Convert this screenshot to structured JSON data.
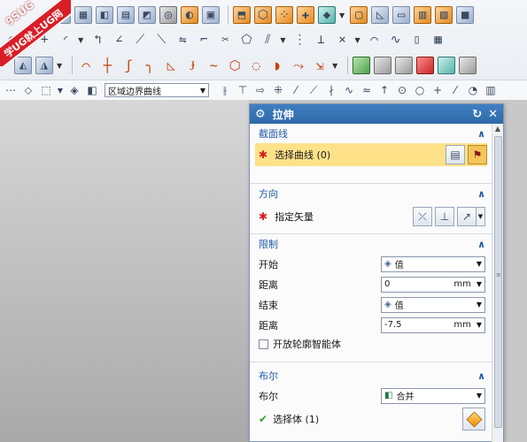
{
  "logo": {
    "brand": "9SUG",
    "tagline": "学UG就上UG网"
  },
  "toolbar": {
    "row1": [
      "blend-icon",
      "mesh-icon",
      "sketch-sheet-icon",
      "grid-surface-icon",
      "patch-icon",
      "tube-icon",
      "split-face-icon",
      "cube-feature-icon",
      "offset-face-icon",
      "pattern-icon",
      "dots-icon",
      "shape-add-icon",
      "color-shape-icon",
      "box-icon",
      "slope-icon",
      "flat-plate-icon",
      "panel-icon",
      "window-icon",
      "solid-cube-icon",
      "shade-face-icon",
      "sheet-icon"
    ],
    "row2": [
      "circle-icon",
      "plus-icon",
      "fillet-sketch-icon",
      "dimension-icon",
      "angle-icon",
      "trim-icon",
      "extend-icon",
      "mirror-icon",
      "corner-icon",
      "split-icon",
      "polygon-icon",
      "offset-icon",
      "pattern-curve-icon",
      "project-icon",
      "intersect-icon",
      "bridge-icon",
      "blend-curve-icon",
      "pipe-icon",
      "table-icon"
    ],
    "row3": [
      "curve-a-icon",
      "curve-b-icon",
      "curve-c-icon",
      "curve-d-icon",
      "curve-e-icon",
      "curve-f-icon",
      "curve-g-icon",
      "curve-h-icon",
      "curve-i-icon",
      "curve-j-icon",
      "curve-k-icon",
      "curve-l-icon",
      "solid-green-icon",
      "solid-gray-icon",
      "solid-gray2-icon",
      "solid-red-icon",
      "solid-teal-icon",
      "solid-gray3-icon"
    ]
  },
  "selbar": {
    "curve_rule": "区域边界曲线"
  },
  "dialog": {
    "title": "拉伸",
    "sections": {
      "section": {
        "title": "截面线",
        "select_curve": "选择曲线 (0)"
      },
      "direction": {
        "title": "方向",
        "specify_vector": "指定矢量"
      },
      "limits": {
        "title": "限制",
        "start_label": "开始",
        "start_value": "值",
        "dist1_label": "距离",
        "dist1_value": "0",
        "dist1_unit": "mm",
        "end_label": "结束",
        "end_value": "值",
        "dist2_label": "距离",
        "dist2_value": "-7.5",
        "dist2_unit": "mm",
        "open_profile": "开放轮廓智能体"
      },
      "boolean": {
        "title": "布尔",
        "bool_label": "布尔",
        "bool_value": "合并",
        "select_body": "选择体 (1)"
      }
    }
  }
}
